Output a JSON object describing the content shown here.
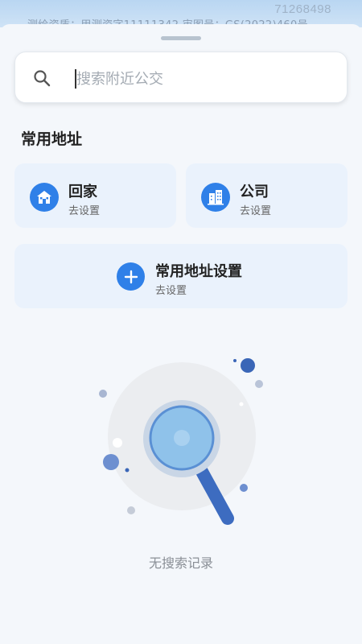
{
  "map": {
    "copyright": "测绘资质：甲测资字11111342 审图号：GS(2022)460号",
    "number": "71268498"
  },
  "search": {
    "placeholder": "搜索附近公交"
  },
  "common_addresses": {
    "title": "常用地址",
    "home": {
      "label": "回家",
      "sub": "去设置"
    },
    "company": {
      "label": "公司",
      "sub": "去设置"
    },
    "settings": {
      "label": "常用地址设置",
      "sub": "去设置"
    }
  },
  "empty_state": {
    "text": "无搜索记录"
  },
  "colors": {
    "accent": "#2f80e8",
    "card_bg": "#eaf2fc",
    "page_bg": "#f4f7fb"
  }
}
